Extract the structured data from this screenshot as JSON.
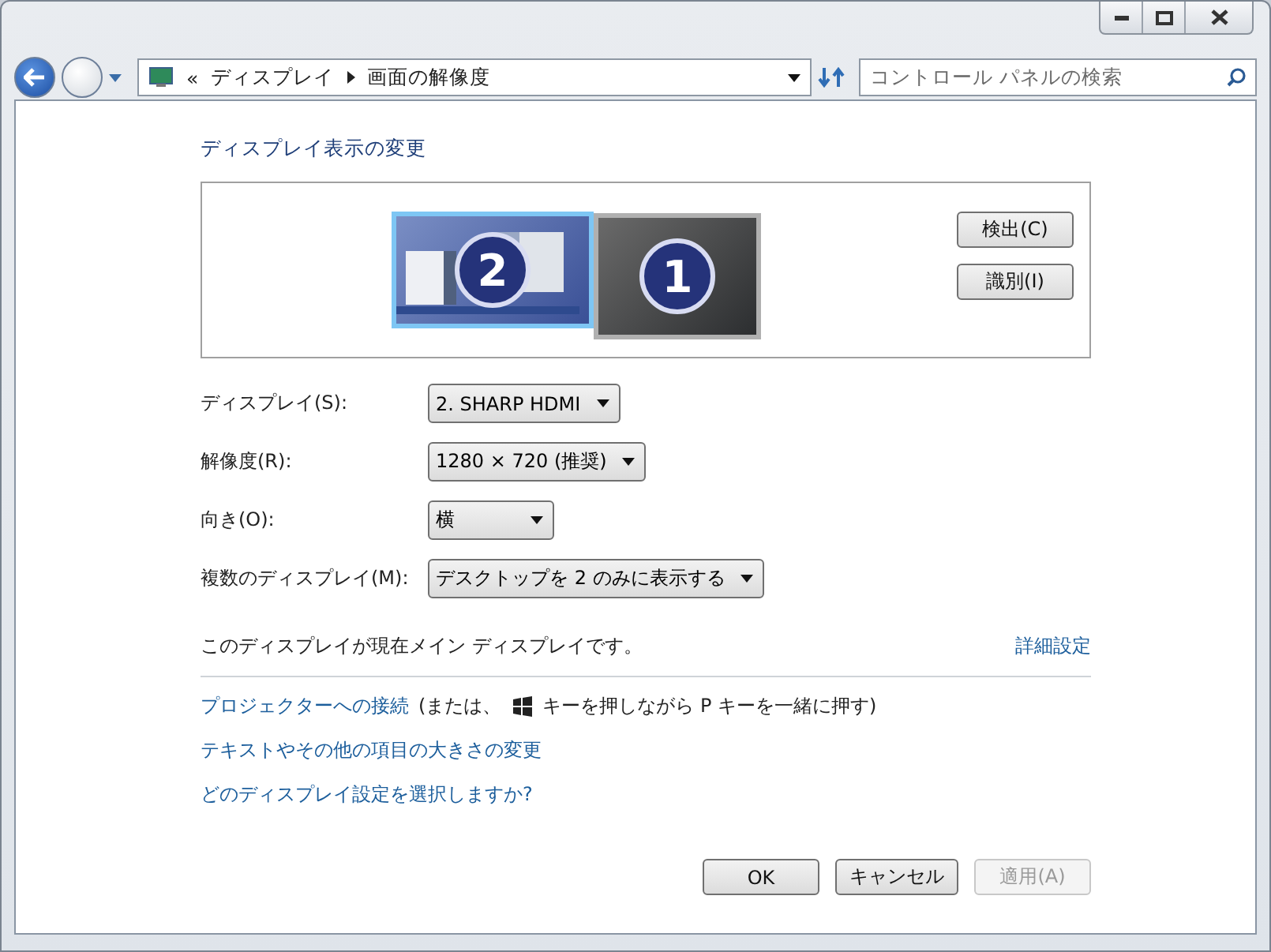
{
  "breadcrumb": {
    "overflow": "«",
    "items": [
      "ディスプレイ",
      "画面の解像度"
    ]
  },
  "search": {
    "placeholder": "コントロール パネルの検索"
  },
  "heading": "ディスプレイ表示の変更",
  "monitors": [
    {
      "number": "2",
      "selected": true,
      "kind": "desktop"
    },
    {
      "number": "1",
      "selected": false,
      "kind": "blank"
    }
  ],
  "monitor_buttons": [
    "検出(C)",
    "識別(I)"
  ],
  "settings": [
    {
      "label": "ディスプレイ(S):",
      "value": "2. SHARP HDMI"
    },
    {
      "label": "解像度(R):",
      "value": "1280 × 720 (推奨)"
    },
    {
      "label": "向き(O):",
      "value": "横"
    },
    {
      "label": "複数のディスプレイ(M):",
      "value": "デスクトップを 2 のみに表示する"
    }
  ],
  "status": "このディスプレイが現在メイン ディスプレイです。",
  "advanced_link": "詳細設定",
  "projector": {
    "link": "プロジェクターへの接続",
    "before_icon": "(または、",
    "after_icon": "キーを押しながら P キーを一緒に押す)"
  },
  "links": [
    "テキストやその他の項目の大きさの変更",
    "どのディスプレイ設定を選択しますか?"
  ],
  "buttons": [
    {
      "label": "OK",
      "disabled": false
    },
    {
      "label": "キャンセル",
      "disabled": false
    },
    {
      "label": "適用(A)",
      "disabled": true
    }
  ]
}
